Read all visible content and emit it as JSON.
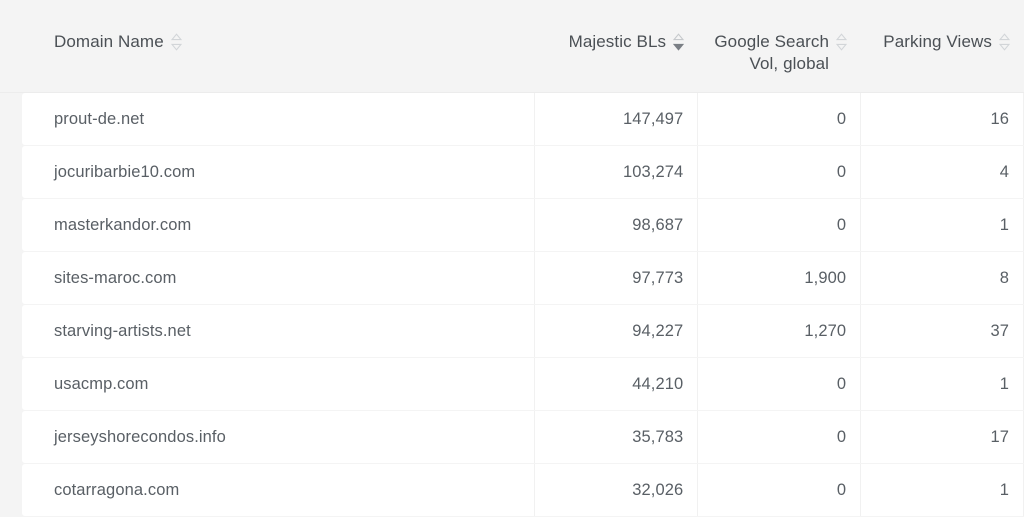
{
  "table": {
    "columns": [
      {
        "key": "domain",
        "label": "Domain Name",
        "align": "left",
        "sort_icon": "sort-updown-icon",
        "sort_state": "none"
      },
      {
        "key": "majestic",
        "label": "Majestic BLs",
        "align": "right",
        "sort_icon": "sort-updown-icon",
        "sort_state": "descending"
      },
      {
        "key": "google",
        "label": "Google Search\nVol, global",
        "align": "right",
        "sort_icon": "sort-updown-icon",
        "sort_state": "none"
      },
      {
        "key": "parking",
        "label": "Parking Views",
        "align": "right",
        "sort_icon": "sort-updown-icon",
        "sort_state": "none"
      }
    ],
    "rows": [
      {
        "domain": "prout-de.net",
        "majestic": "147,497",
        "google": "0",
        "parking": "16"
      },
      {
        "domain": "jocuribarbie10.com",
        "majestic": "103,274",
        "google": "0",
        "parking": "4"
      },
      {
        "domain": "masterkandor.com",
        "majestic": "98,687",
        "google": "0",
        "parking": "1"
      },
      {
        "domain": "sites-maroc.com",
        "majestic": "97,773",
        "google": "1,900",
        "parking": "8"
      },
      {
        "domain": "starving-artists.net",
        "majestic": "94,227",
        "google": "1,270",
        "parking": "37"
      },
      {
        "domain": "usacmp.com",
        "majestic": "44,210",
        "google": "0",
        "parking": "1"
      },
      {
        "domain": "jerseyshorecondos.info",
        "majestic": "35,783",
        "google": "0",
        "parking": "17"
      },
      {
        "domain": "cotarragona.com",
        "majestic": "32,026",
        "google": "0",
        "parking": "1"
      }
    ]
  },
  "colors": {
    "page_background": "#f4f4f4",
    "row_background": "#ffffff",
    "header_text": "#4b5055",
    "cell_text": "#595f65",
    "divider": "#f1f1f1",
    "sort_icon_idle": "#d2d5d8",
    "sort_icon_active": "#7a7f85"
  }
}
